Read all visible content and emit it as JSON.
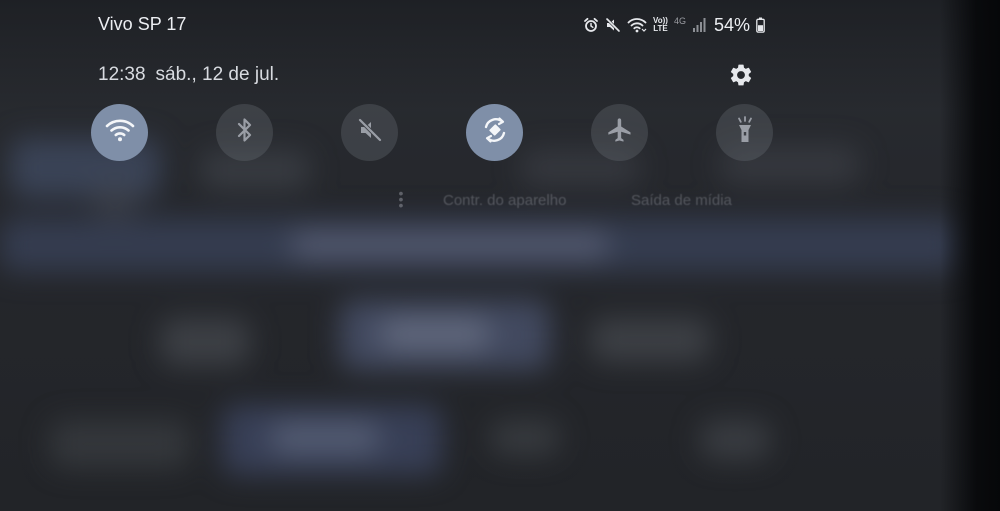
{
  "status_bar": {
    "carrier": "Vivo SP 17",
    "icons": [
      "alarm-icon",
      "mute-icon",
      "wifi-icon",
      "volte-icon",
      "network-4g-icon",
      "signal-icon",
      "battery-icon"
    ],
    "volte_top": "Vo))",
    "volte_bottom": "LTE",
    "network_type": "4G",
    "battery_percent": "54%"
  },
  "header": {
    "time": "12:38",
    "date": "sáb., 12 de jul.",
    "settings_icon": "gear-icon"
  },
  "quick_settings": [
    {
      "name": "wifi",
      "icon": "wifi-icon",
      "active": true
    },
    {
      "name": "bluetooth",
      "icon": "bluetooth-icon",
      "active": false
    },
    {
      "name": "sound",
      "icon": "sound-muted-icon",
      "active": false
    },
    {
      "name": "auto-rotate",
      "icon": "auto-rotate-icon",
      "active": true
    },
    {
      "name": "airplane-mode",
      "icon": "airplane-icon",
      "active": false
    },
    {
      "name": "flashlight",
      "icon": "flashlight-icon",
      "active": false
    }
  ],
  "background_labels": {
    "device_control": "Contr. do aparelho",
    "media_output": "Saída de mídia"
  },
  "colors": {
    "active_tile": "#7f8fa8",
    "inactive_tile": "#3a3d43",
    "text_primary": "#eceef2"
  }
}
